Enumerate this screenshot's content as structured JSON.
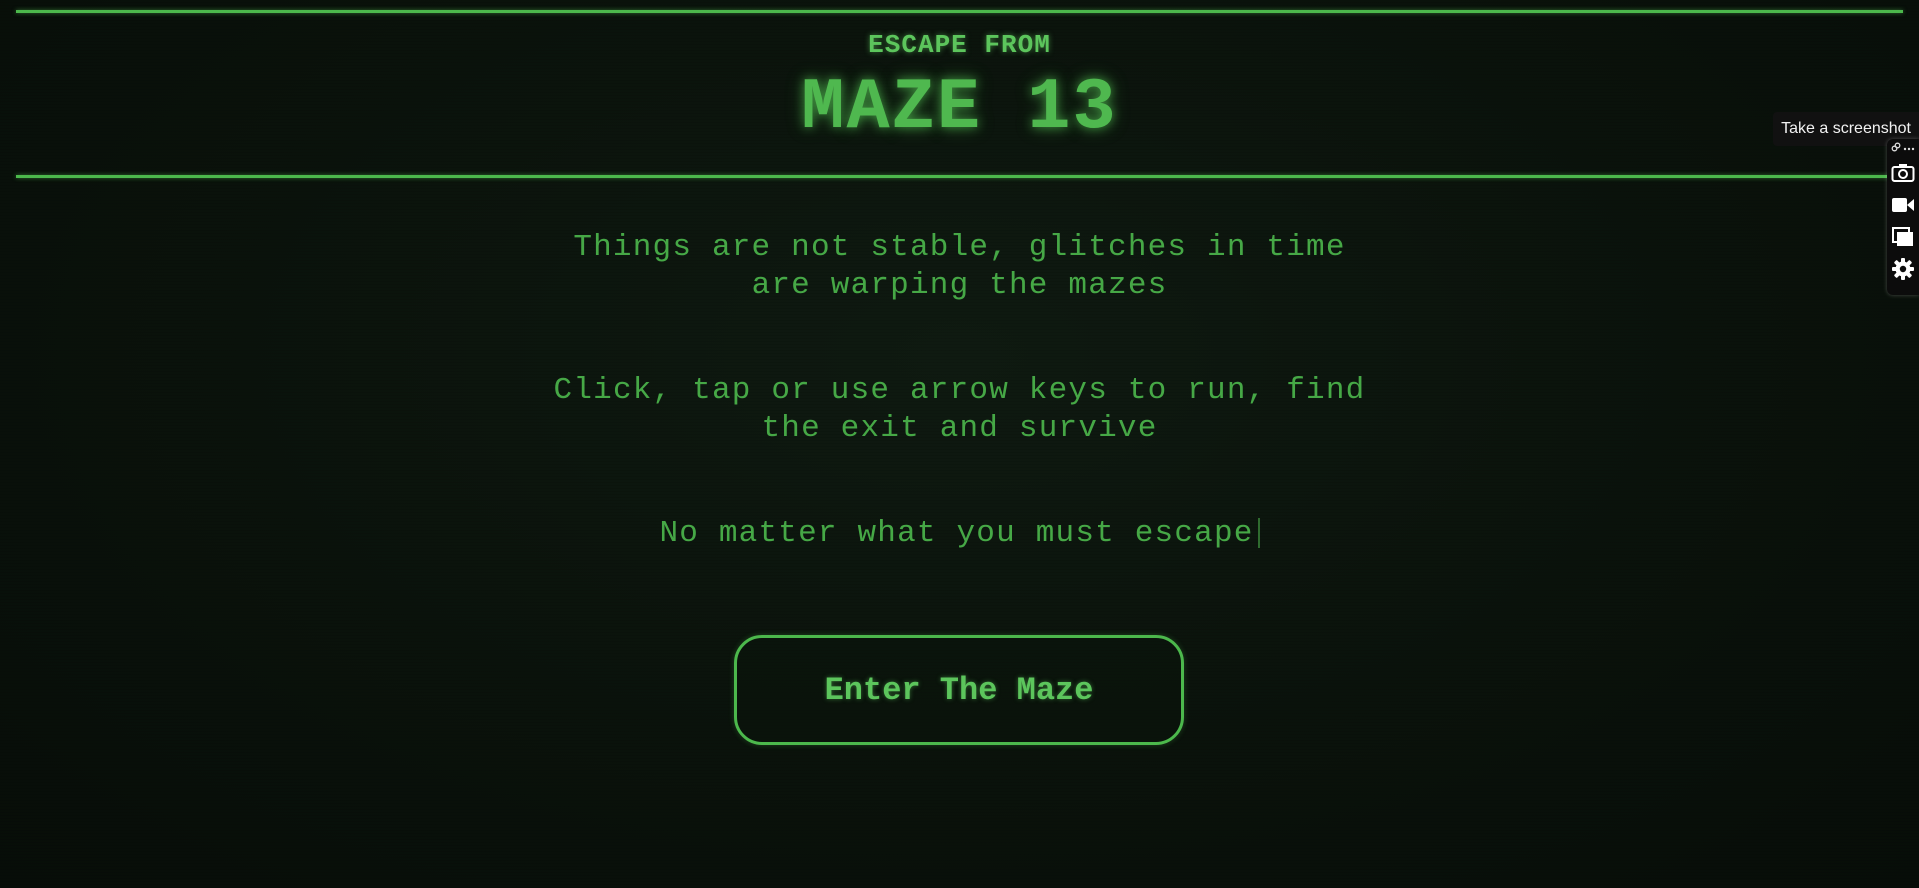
{
  "header": {
    "subtitle": "ESCAPE FROM",
    "title": "MAZE 13"
  },
  "intro": {
    "line1a": "Things are not stable, glitches in time",
    "line1b": "are warping the mazes",
    "line2a": "Click, tap or use arrow keys to run, find",
    "line2b": "the exit and survive",
    "line3": "No matter what you must escape"
  },
  "enter_button": {
    "label": "Enter The Maze"
  },
  "screenshot_tool": {
    "tooltip": "Take a screenshot",
    "icons": [
      "link-icon",
      "more-icon",
      "camera-icon",
      "video-icon",
      "windows-icon",
      "gear-icon"
    ]
  },
  "colors": {
    "accent": "#4cb84c",
    "background": "#0a120b"
  }
}
